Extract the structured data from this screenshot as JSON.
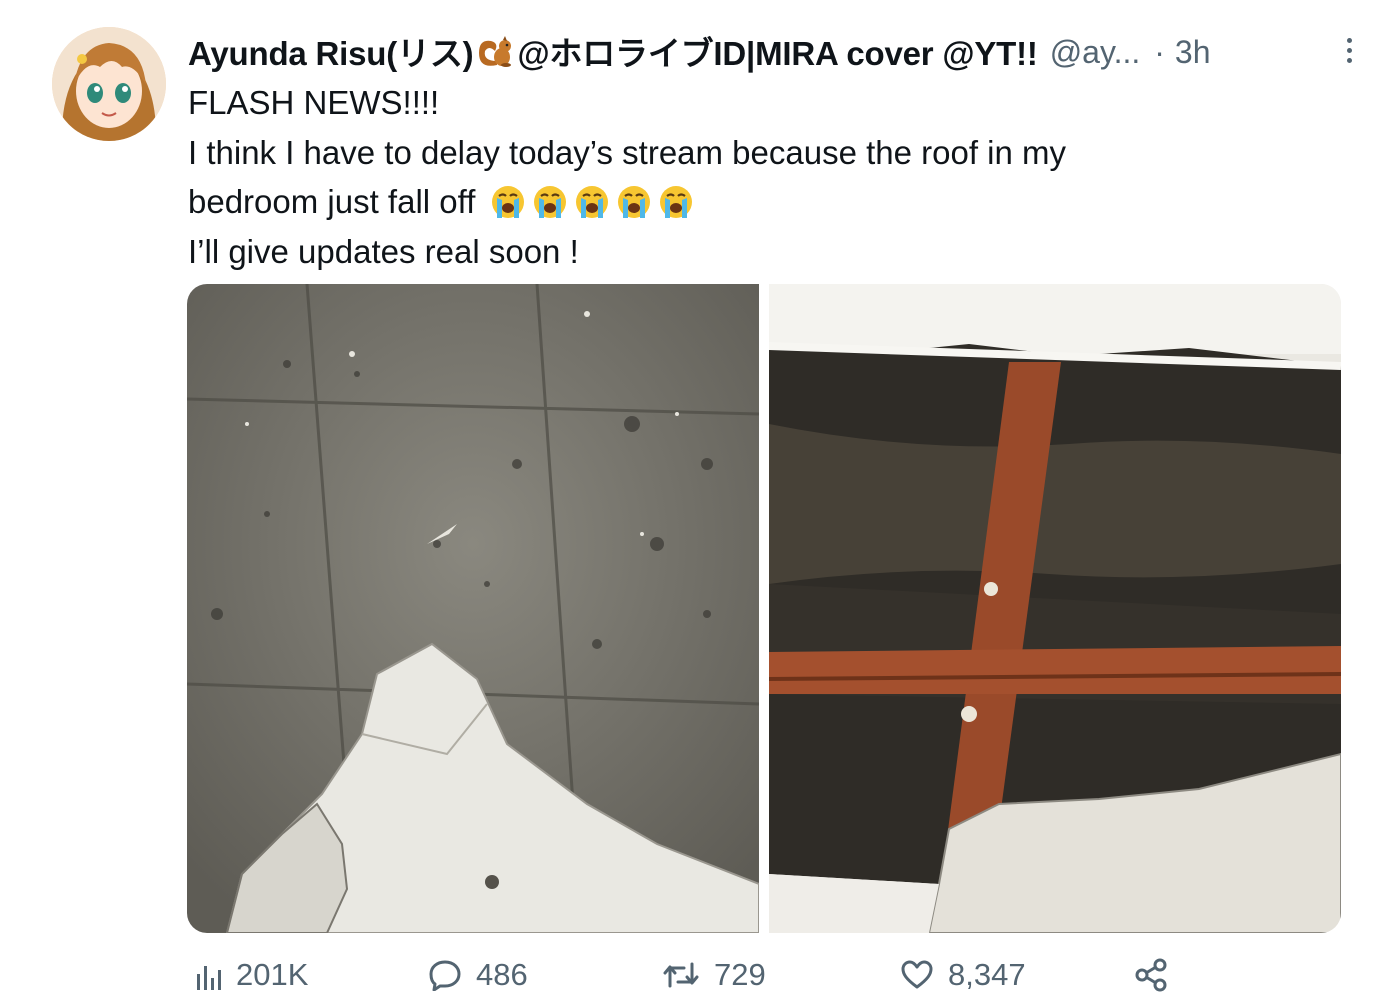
{
  "tweet": {
    "display_name_before": "Ayunda Risu(リス)",
    "display_name_after": "@ホロライブID|MIRA cover @YT!!",
    "handle": "@ay...",
    "separator": "·",
    "time": "3h",
    "text_lines": [
      "FLASH NEWS!!!!",
      "I think I have to delay today’s stream because the roof in my",
      "bedroom just fall off",
      "I’ll give updates real soon !"
    ],
    "emoji_name": "loudly-crying-face-emoji",
    "emoji_count": 5,
    "avatar_icon": "anime-girl-avatar-icon",
    "media": [
      {
        "icon": "fallen-ceiling-on-floor-photo"
      },
      {
        "icon": "broken-ceiling-photo"
      }
    ]
  },
  "actions": {
    "views": "201K",
    "replies": "486",
    "retweets": "729",
    "likes": "8,347"
  },
  "colors": {
    "text": "#0f1419",
    "secondary": "#536471",
    "background": "#ffffff"
  }
}
